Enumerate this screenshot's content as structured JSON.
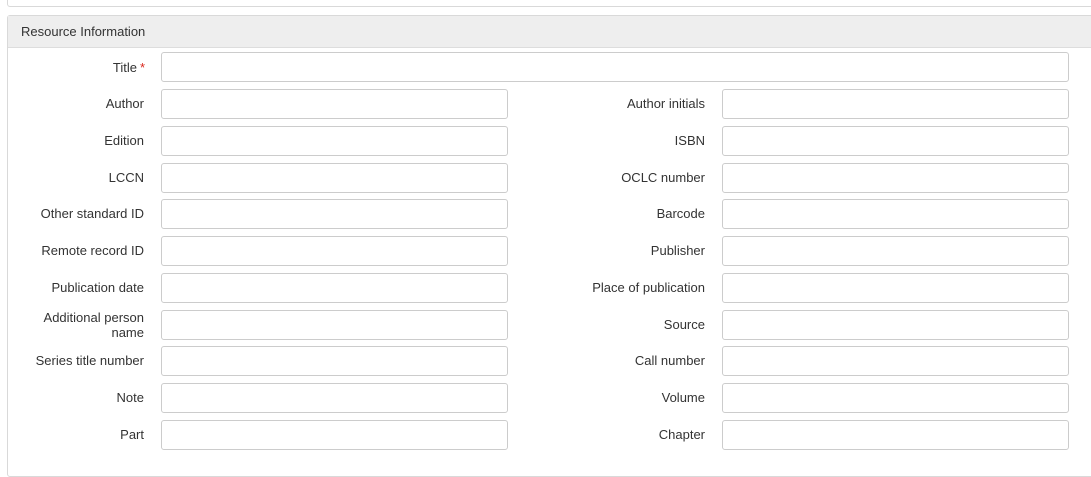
{
  "section": {
    "title": "Resource Information"
  },
  "title_field": {
    "label": "Title",
    "required_marker": "*",
    "value": ""
  },
  "rows": [
    {
      "left_label": "Author",
      "left_value": "",
      "right_label": "Author initials",
      "right_value": ""
    },
    {
      "left_label": "Edition",
      "left_value": "",
      "right_label": "ISBN",
      "right_value": ""
    },
    {
      "left_label": "LCCN",
      "left_value": "",
      "right_label": "OCLC number",
      "right_value": ""
    },
    {
      "left_label": "Other standard ID",
      "left_value": "",
      "right_label": "Barcode",
      "right_value": ""
    },
    {
      "left_label": "Remote record ID",
      "left_value": "",
      "right_label": "Publisher",
      "right_value": ""
    },
    {
      "left_label": "Publication date",
      "left_value": "",
      "right_label": "Place of publication",
      "right_value": ""
    },
    {
      "left_label": "Additional person name",
      "left_value": "",
      "right_label": "Source",
      "right_value": ""
    },
    {
      "left_label": "Series title number",
      "left_value": "",
      "right_label": "Call number",
      "right_value": ""
    },
    {
      "left_label": "Note",
      "left_value": "",
      "right_label": "Volume",
      "right_value": ""
    },
    {
      "left_label": "Part",
      "left_value": "",
      "right_label": "Chapter",
      "right_value": ""
    }
  ],
  "colors": {
    "required": "#d9261c",
    "header_bg": "#eeeeee",
    "border": "#cccccc"
  }
}
